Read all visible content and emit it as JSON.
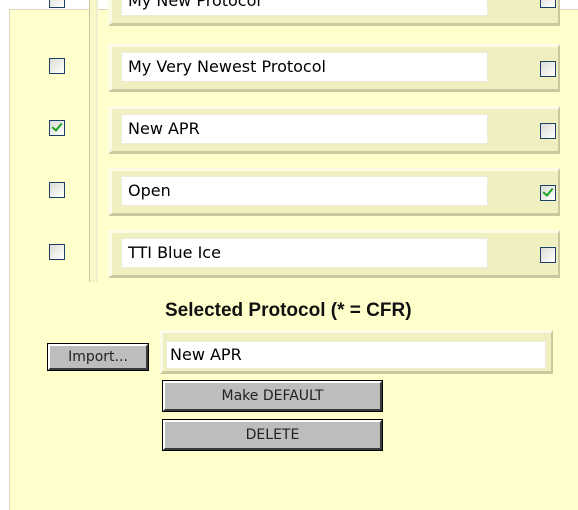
{
  "protocols": [
    {
      "name": "My New Protocol",
      "selected": false,
      "default": false
    },
    {
      "name": "My Very Newest Protocol",
      "selected": false,
      "default": false
    },
    {
      "name": "New APR",
      "selected": true,
      "default": false
    },
    {
      "name": "Open",
      "selected": false,
      "default": true
    },
    {
      "name": "TTI Blue Ice",
      "selected": false,
      "default": false
    }
  ],
  "selected_section": {
    "heading": "Selected Protocol (* = CFR)",
    "import_label": "Import...",
    "current_value": "New APR",
    "make_default_label": "Make DEFAULT",
    "delete_label": "DELETE"
  },
  "colors": {
    "panel_background": "#ffffcc",
    "check_mark": "#21a121",
    "checkbox_border": "#1d3f68",
    "button_face": "#bdbdbd"
  }
}
